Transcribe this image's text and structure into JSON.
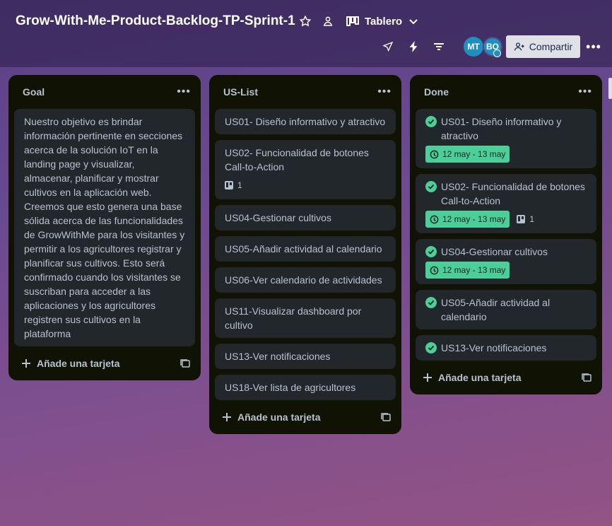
{
  "board": {
    "title": "Grow-With-Me-Product-Backlog-TP-Sprint-1",
    "view_label": "Tablero",
    "share_label": "Compartir",
    "members": [
      "MT",
      "BO"
    ]
  },
  "icons": {
    "star": "star-icon",
    "people": "workspace-visible-icon",
    "board_view": "board-view-icon",
    "chevron": "chevron-down-icon",
    "rocket": "power-ups-icon",
    "bolt": "automation-icon",
    "filter": "filter-icon",
    "more": "more-icon"
  },
  "colors": {
    "date_badge": "#4bce97",
    "list_bg": "#101204",
    "card_bg": "#22272b"
  },
  "lists": [
    {
      "title": "Goal",
      "add_label": "Añade una tarjeta",
      "cards": [
        {
          "text": "Nuestro objetivo es brindar información pertinente en secciones acerca de la solución IoT en la landing page y visualizar, almacenar, planificar y mostrar cultivos en la aplicación web. Creemos que esto genera una base sólida acerca de las funcionalidades de GrowWithMe para los visitantes y permitir a los agricultores registrar y planificar sus cultivos. Esto será confirmado cuando los visitantes se suscriban para acceder a las aplicaciones y los agricultores registren sus cultivos en la plataforma"
        }
      ]
    },
    {
      "title": "US-List",
      "add_label": "Añade una tarjeta",
      "cards": [
        {
          "text": "US01- Diseño informativo y atractivo"
        },
        {
          "text": "US02- Funcionalidad de botones Call-to-Action",
          "attachments": "1"
        },
        {
          "text": "US04-Gestionar cultivos"
        },
        {
          "text": "US05-Añadir actividad al calendario"
        },
        {
          "text": "US06-Ver calendario de actividades"
        },
        {
          "text": "US11-Visualizar dashboard por cultivo"
        },
        {
          "text": "US13-Ver notificaciones"
        },
        {
          "text": "US18-Ver lista de agricultores"
        }
      ]
    },
    {
      "title": "Done",
      "add_label": "Añade una tarjeta",
      "cards": [
        {
          "text": "US01- Diseño informativo y atractivo",
          "date": "12 may - 13 may"
        },
        {
          "text": "US02- Funcionalidad de botones Call-to-Action",
          "date": "12 may - 13 may",
          "attachments": "1"
        },
        {
          "text": "US04-Gestionar cultivos",
          "date": "12 may - 13 may"
        },
        {
          "text": "US05-Añadir actividad al calendario"
        },
        {
          "text": "US13-Ver notificaciones"
        }
      ]
    }
  ]
}
